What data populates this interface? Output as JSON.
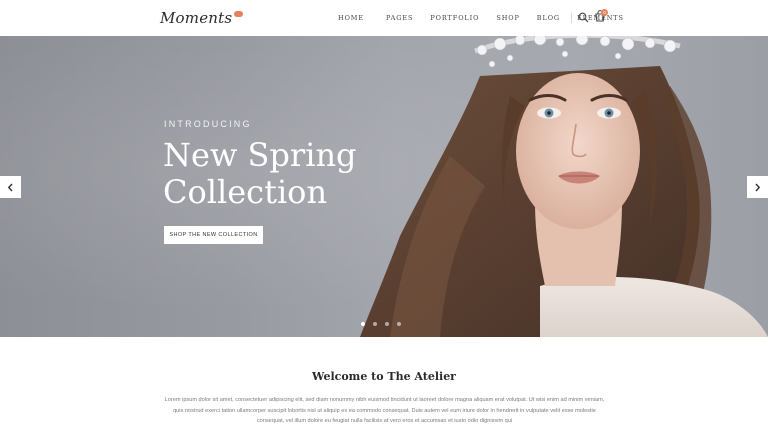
{
  "header": {
    "logo_text": "Moments",
    "nav": [
      "HOME",
      "PAGES",
      "PORTFOLIO",
      "SHOP",
      "BLOG",
      "ELEMENTS"
    ],
    "cart_count": "0"
  },
  "hero": {
    "eyebrow": "INTRODUCING",
    "title": "New Spring Collection",
    "button_label": "SHOP THE NEW COLLECTION",
    "active_slide": 1,
    "slide_count": 4
  },
  "welcome": {
    "title": "Welcome to The Atelier",
    "body": "Lorem ipsum dolor sit amet, consectetuer adipiscing elit, sed diam nonummy nibh euismod tincidunt ut laoreet dolore magna aliquam erat volutpat. Ut wisi enim ad minim veniam, quis nostrud exerci tation ullamcorper suscipit lobortis nisl ut aliquip ex ea commodo consequat. Duis autem vel eum iriure dolor in hendrerit in vulputate velit esse molestie consequat, vel illum dolore eu feugiat nulla facilisis at vero eros et accumsan et iusto odio dignissim qui"
  },
  "colors": {
    "accent": "#e3825f",
    "text_dark": "#2b2b2b",
    "hero_bg": "#9a9ca3"
  },
  "icons": [
    "search-icon",
    "cart-icon",
    "chevron-left-icon",
    "chevron-right-icon"
  ]
}
